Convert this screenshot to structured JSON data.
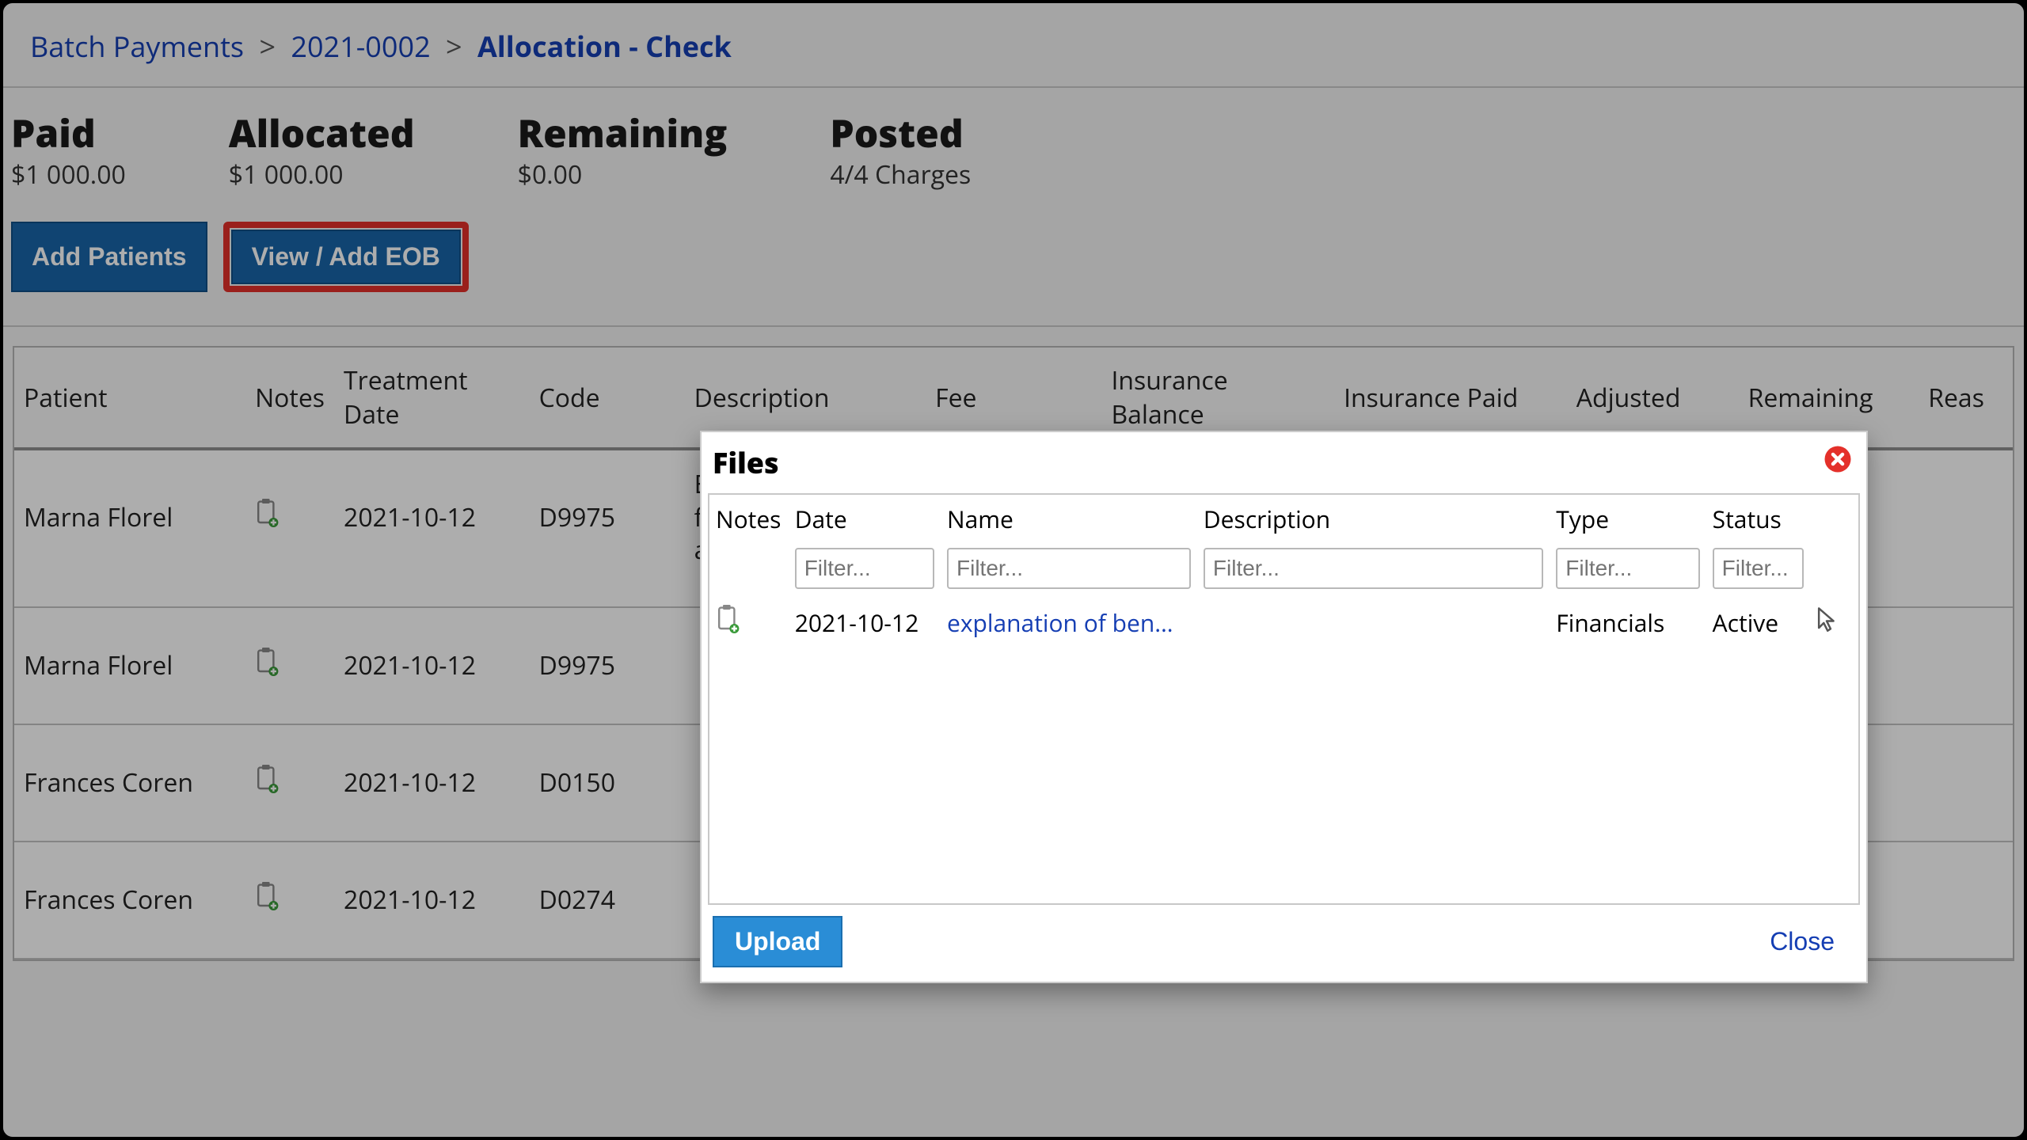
{
  "breadcrumb": {
    "root": "Batch Payments",
    "mid": "2021-0002",
    "current": "Allocation - Check",
    "sep": ">"
  },
  "summary": {
    "paid_label": "Paid",
    "paid_value": "$1 000.00",
    "alloc_label": "Allocated",
    "alloc_value": "$1 000.00",
    "remain_label": "Remaining",
    "remain_value": "$0.00",
    "posted_label": "Posted",
    "posted_value": "4/4 Charges"
  },
  "buttons": {
    "add_patients": "Add Patients",
    "view_add_eob": "View / Add EOB"
  },
  "columns": {
    "patient": "Patient",
    "notes": "Notes",
    "treatment_date": "Treatment Date",
    "code": "Code",
    "description": "Description",
    "fee": "Fee",
    "insurance_balance": "Insurance Balance",
    "insurance_paid": "Insurance Paid",
    "adjusted": "Adjusted",
    "remaining": "Remaining",
    "reason": "Reas"
  },
  "rows": [
    {
      "patient": "Marna Florel",
      "date": "2021-10-12",
      "code": "D9975",
      "desc": "External bleaching for home application, per"
    },
    {
      "patient": "Marna Florel",
      "date": "2021-10-12",
      "code": "D9975",
      "desc": ""
    },
    {
      "patient": "Frances Coren",
      "date": "2021-10-12",
      "code": "D0150",
      "desc": ""
    },
    {
      "patient": "Frances Coren",
      "date": "2021-10-12",
      "code": "D0274",
      "desc": ""
    }
  ],
  "modal": {
    "title": "Files",
    "headers": {
      "notes": "Notes",
      "date": "Date",
      "name": "Name",
      "description": "Description",
      "type": "Type",
      "status": "Status"
    },
    "filter_placeholder": "Filter...",
    "row": {
      "date": "2021-10-12",
      "name": "explanation of benefi…",
      "description": "",
      "type": "Financials",
      "status": "Active"
    },
    "upload": "Upload",
    "close": "Close"
  }
}
